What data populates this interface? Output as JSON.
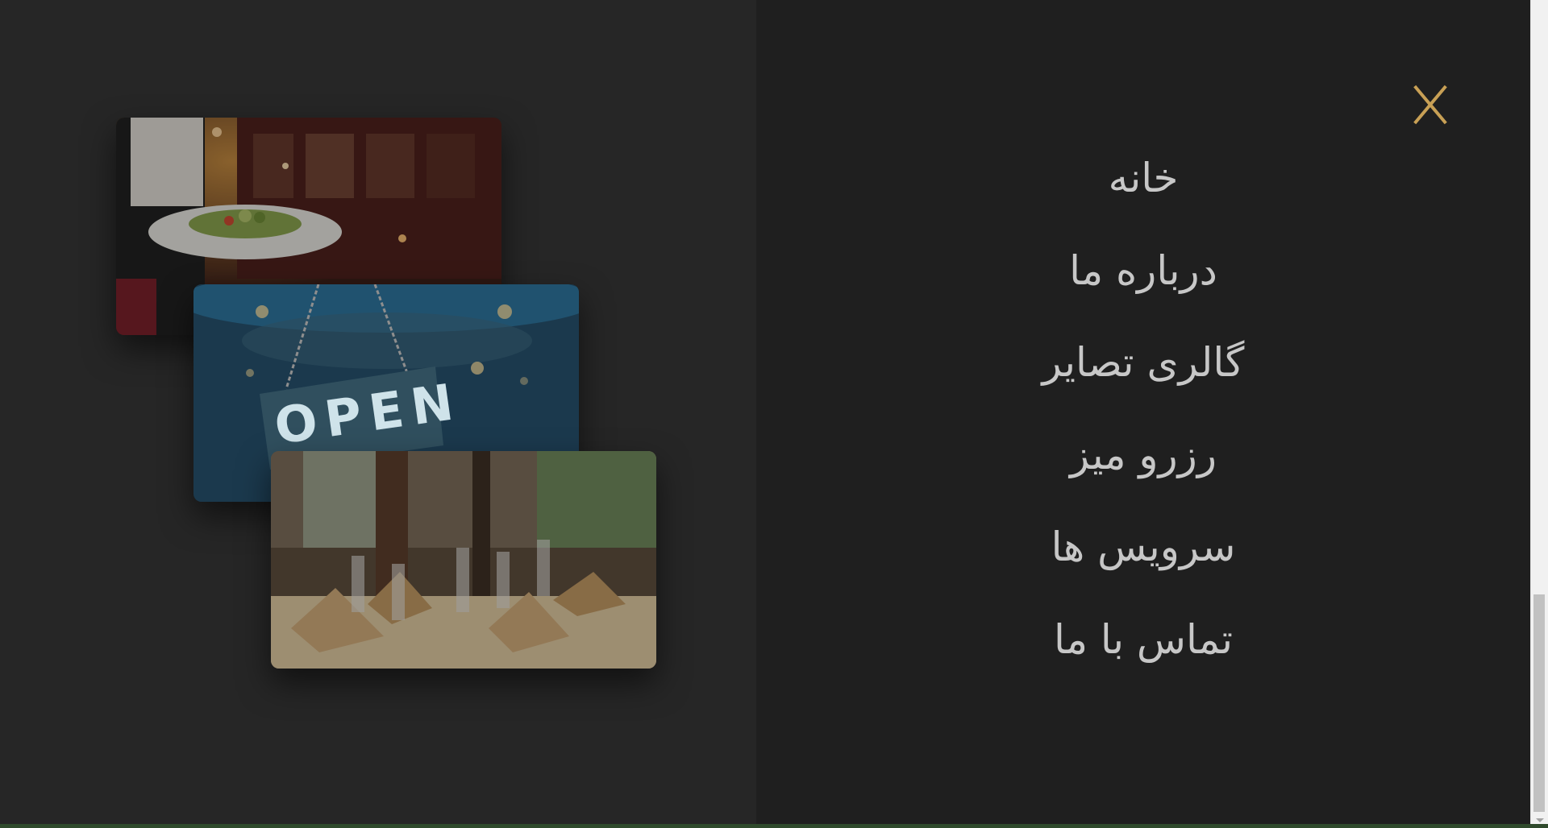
{
  "menu": {
    "close_icon": "close-icon",
    "accent_color": "#c8a055",
    "items": [
      {
        "label": "خانه"
      },
      {
        "label": "درباره ما"
      },
      {
        "label": "گالری تصایر"
      },
      {
        "label": "رزرو میز"
      },
      {
        "label": "سرویس ها"
      },
      {
        "label": "تماس با ما"
      }
    ]
  },
  "images": [
    {
      "name": "waiter-serving-salad-photo"
    },
    {
      "name": "open-sign-photo",
      "sign_text": "OPEN"
    },
    {
      "name": "restaurant-table-setting-photo"
    }
  ]
}
